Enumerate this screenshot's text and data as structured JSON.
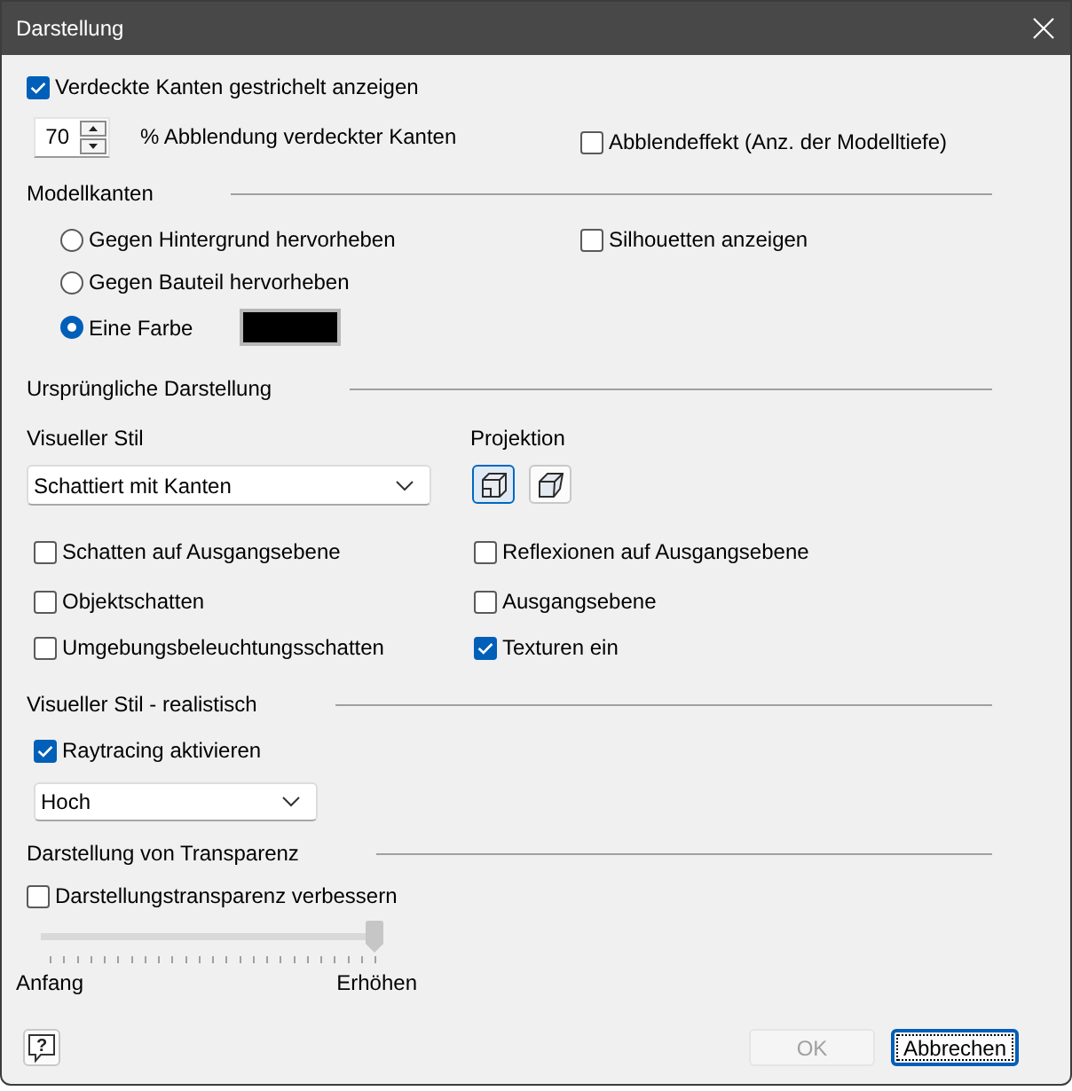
{
  "window": {
    "title": "Darstellung"
  },
  "hidden_edges": {
    "label": "Verdeckte Kanten gestrichelt anzeigen",
    "checked": true
  },
  "dimming": {
    "value": "70",
    "label": "% Abblendung verdeckter Kanten"
  },
  "depth_dimming": {
    "label": "Abblendeffekt (Anz. der Modelltiefe)",
    "checked": false
  },
  "model_edges": {
    "title": "Modellkanten",
    "options": [
      {
        "label": "Gegen Hintergrund hervorheben",
        "selected": false
      },
      {
        "label": "Gegen Bauteil hervorheben",
        "selected": false
      },
      {
        "label": "Eine Farbe",
        "selected": true
      }
    ],
    "silhouettes": {
      "label": "Silhouetten anzeigen",
      "checked": false
    },
    "color": "#000000"
  },
  "initial_display": {
    "title": "Ursprüngliche Darstellung",
    "visual_style": {
      "label": "Visueller Stil",
      "value": "Schattiert mit Kanten"
    },
    "projection": {
      "label": "Projektion",
      "options": [
        {
          "kind": "orthographic",
          "selected": true
        },
        {
          "kind": "perspective",
          "selected": false
        }
      ]
    },
    "options": [
      {
        "label": "Schatten auf Ausgangsebene",
        "checked": false
      },
      {
        "label": "Reflexionen auf Ausgangsebene",
        "checked": false
      },
      {
        "label": "Objektschatten",
        "checked": false
      },
      {
        "label": "Ausgangsebene",
        "checked": false
      },
      {
        "label": "Umgebungsbeleuchtungsschatten",
        "checked": false
      },
      {
        "label": "Texturen ein",
        "checked": true
      }
    ]
  },
  "realistic": {
    "title": "Visueller Stil - realistisch",
    "raytracing": {
      "label": "Raytracing aktivieren",
      "checked": true
    },
    "quality": "Hoch"
  },
  "transparency": {
    "title": "Darstellung von Transparenz",
    "improve": {
      "label": "Darstellungstransparenz verbessern",
      "checked": false
    },
    "slider": {
      "level": 1,
      "disabled": true,
      "min_label": "Anfang",
      "max_label": "Erhöhen"
    }
  },
  "footer": {
    "help": "?",
    "buttons": [
      {
        "label": "OK",
        "disabled": true,
        "focused": false
      },
      {
        "label": "Abbrechen",
        "disabled": false,
        "focused": true
      }
    ]
  }
}
